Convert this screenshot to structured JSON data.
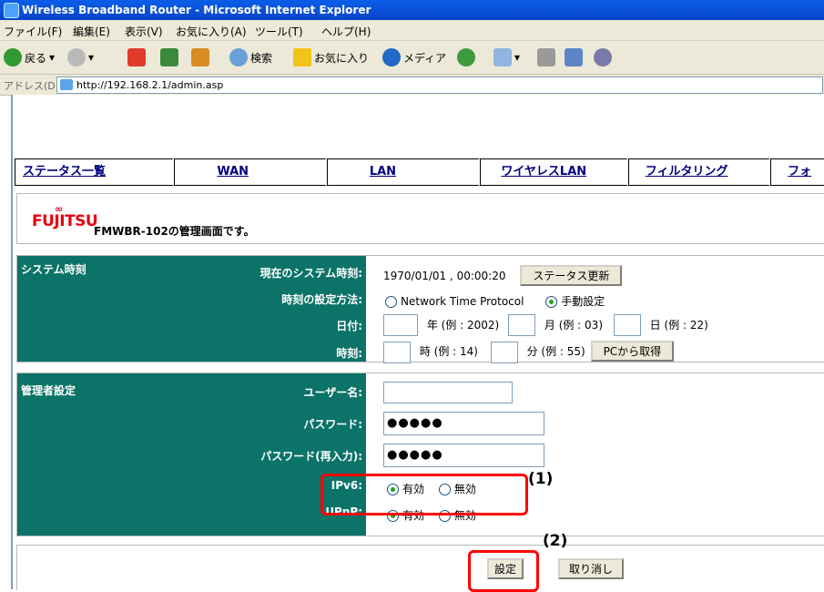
{
  "window": {
    "title": "Wireless Broadband Router - Microsoft Internet Explorer"
  },
  "menu": [
    "ファイル(F)",
    "編集(E)",
    "表示(V)",
    "お気に入り(A)",
    "ツール(T)",
    "ヘルプ(H)"
  ],
  "toolbar": {
    "back": "戻る",
    "search": "検索",
    "favorites": "お気に入り",
    "media": "メディア"
  },
  "address": {
    "label": "アドレス(D)",
    "url": "http://192.168.2.1/admin.asp"
  },
  "nav": [
    "ステータス一覧",
    "WAN",
    "LAN",
    "ワイヤレスLAN",
    "フィルタリング",
    "フォ"
  ],
  "header": {
    "logo": "FUJITSU",
    "text": "FMWBR-102の管理画面です。"
  },
  "system_time": {
    "section": "システム時刻",
    "current_label": "現在のシステム時刻:",
    "current_value": "1970/01/01 , 00:00:20",
    "refresh_button": "ステータス更新",
    "method_label": "時刻の設定方法:",
    "method_options": [
      "Network Time Protocol",
      "手動設定"
    ],
    "method_selected": "手動設定",
    "date_label": "日付:",
    "date_year": "年 (例 : 2002)",
    "date_month": "月 (例 : 03)",
    "date_day": "日 (例 : 22)",
    "time_label": "時刻:",
    "time_hour": "時 (例 : 14)",
    "time_min": "分 (例 : 55)",
    "pc_button": "PCから取得"
  },
  "admin": {
    "section": "管理者設定",
    "user_label": "ユーザー名:",
    "pass_label": "パスワード:",
    "pass_value": "●●●●●",
    "pass2_label": "パスワード(再入力):",
    "pass2_value": "●●●●●",
    "ipv6_label": "IPv6:",
    "upnp_label": "UPnP:",
    "on_label": "有効",
    "off_label": "無効",
    "ipv6_selected": "有効",
    "upnp_selected": "有効"
  },
  "buttons": {
    "apply": "設定",
    "cancel": "取り消し"
  },
  "annotations": {
    "a1": "(1)",
    "a2": "(2)"
  }
}
